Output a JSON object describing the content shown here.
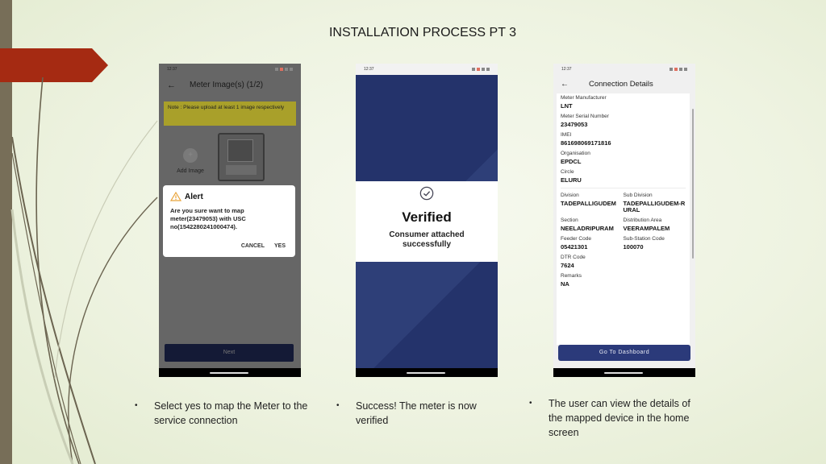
{
  "slide": {
    "title": "INSTALLATION PROCESS PT 3",
    "accent_color": "#a52a12",
    "sidebar_color": "#776e58"
  },
  "phone1": {
    "status_time": "12:37",
    "header_title": "Meter Image(s) (1/2)",
    "note": "Note : Please upload at least 1 image respectively",
    "add_image_label": "Add Image",
    "add_image_icon": "+",
    "alert": {
      "title": "Alert",
      "message": "Are you sure want to map meter(23479053) with USC no(1542280241000474).",
      "cancel_label": "CANCEL",
      "yes_label": "YES"
    },
    "next_label": "Next"
  },
  "phone2": {
    "status_time": "12:37",
    "title": "Verified",
    "subtitle_line1": "Consumer attached",
    "subtitle_line2": "successfully"
  },
  "phone3": {
    "status_time": "12:37",
    "header_title": "Connection Details",
    "fields": {
      "meter_manufacturer": {
        "label": "Meter Manufacturer",
        "value": "LNT"
      },
      "meter_serial": {
        "label": "Meter Serial Number",
        "value": "23479053"
      },
      "imei": {
        "label": "IMEI",
        "value": "861698069171816"
      },
      "organisation": {
        "label": "Organisation",
        "value": "EPDCL"
      },
      "circle": {
        "label": "Circle",
        "value": "ELURU"
      },
      "division": {
        "label": "Division",
        "value": "TADEPALLIGUDEM"
      },
      "sub_division": {
        "label": "Sub Division",
        "value": "TADEPALLIGUDEM-RURAL"
      },
      "section": {
        "label": "Section",
        "value": "NEELADRIPURAM"
      },
      "distribution_area": {
        "label": "Distribution Area",
        "value": "VEERAMPALEM"
      },
      "feeder_code": {
        "label": "Feeder Code",
        "value": "05421301"
      },
      "sub_station_code": {
        "label": "Sub-Station Code",
        "value": "100070"
      },
      "dtr_code": {
        "label": "DTR Code",
        "value": "7624"
      },
      "remarks": {
        "label": "Remarks",
        "value": "NA"
      }
    },
    "dashboard_label": "Go To Dashboard"
  },
  "captions": [
    "Select yes to map the Meter to the service connection",
    "Success! The meter is now verified",
    "The user can view the details of the mapped device in the home screen"
  ],
  "bullet": "•"
}
